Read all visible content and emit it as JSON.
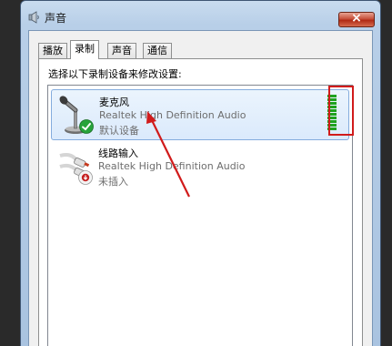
{
  "window": {
    "title": "声音",
    "close_label": "×"
  },
  "tabs": [
    {
      "label": "播放",
      "active": false
    },
    {
      "label": "录制",
      "active": true
    },
    {
      "label": "声音",
      "active": false
    },
    {
      "label": "通信",
      "active": false
    }
  ],
  "instruction": "选择以下录制设备来修改设置:",
  "devices": [
    {
      "name": "麦克风",
      "driver": "Realtek High Definition Audio",
      "status": "默认设备",
      "icon": "microphone-icon",
      "badge": "default-check-icon",
      "selected": true,
      "level": 1.0
    },
    {
      "name": "线路输入",
      "driver": "Realtek High Definition Audio",
      "status": "未插入",
      "icon": "line-in-cable-icon",
      "badge": "unplugged-icon",
      "selected": false
    }
  ],
  "colors": {
    "meter": "#1fa21f",
    "annotation": "#d11b1b",
    "selection": "#dbeafc"
  }
}
